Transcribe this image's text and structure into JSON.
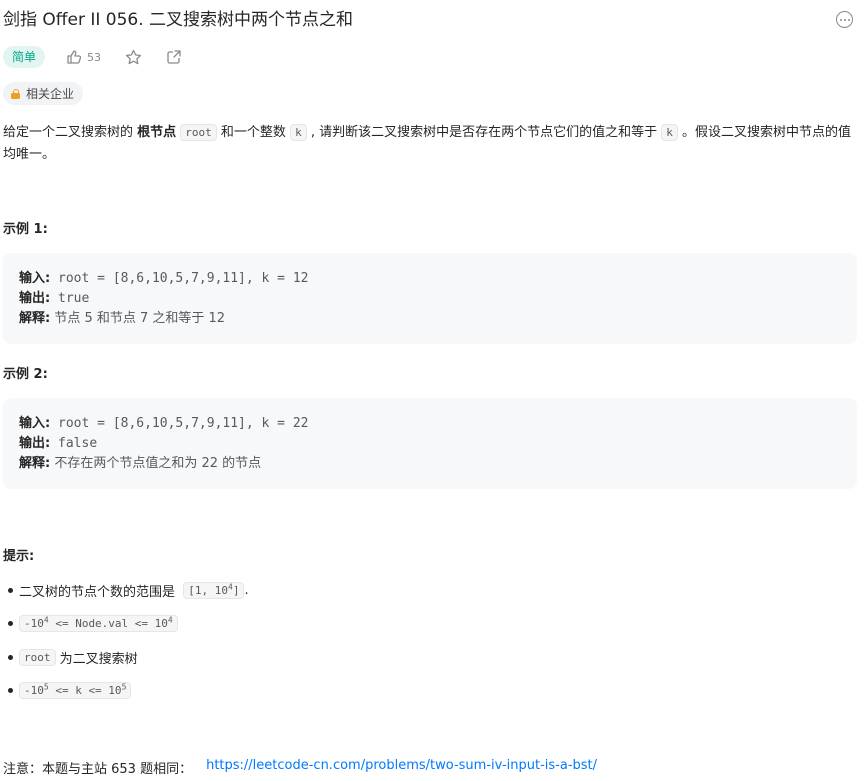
{
  "problem": {
    "title": "剑指 Offer II 056. 二叉搜索树中两个节点之和",
    "difficulty": "简单",
    "likes": "53",
    "company_tag": "相关企业",
    "icons": {
      "more": "more-icon",
      "like": "thumbs-up-icon",
      "star": "star-icon",
      "share": "share-icon",
      "lock": "lock-icon"
    },
    "accent_color": "#00a888"
  },
  "description": {
    "part1": "给定一个二叉搜索树的 ",
    "bold": "根节点",
    "code_root": "root",
    "part2": " 和一个整数 ",
    "code_k": "k",
    "part3": " , 请判断该二叉搜索树中是否存在两个节点它们的值之和等于 ",
    "code_k2": "k",
    "part4": " 。假设二叉搜索树中节点的值均唯一。"
  },
  "examples": [
    {
      "title": "示例 1:",
      "input_label": "输入:",
      "input": " root = [8,6,10,5,7,9,11], k = 12",
      "output_label": "输出:",
      "output": " true",
      "explain_label": "解释:",
      "explain": " 节点 5 和节点 7 之和等于 12"
    },
    {
      "title": "示例 2:",
      "input_label": "输入:",
      "input": " root = [8,6,10,5,7,9,11], k = 22",
      "output_label": "输出:",
      "output": " false",
      "explain_label": "解释:",
      "explain": " 不存在两个节点值之和为 22 的节点"
    }
  ],
  "hints": {
    "title": "提示:",
    "h1_text": "二叉树的节点个数的范围是",
    "h1_code_a": "[1, 10",
    "h1_code_exp": "4",
    "h1_code_b": "]",
    "h1_tail": ".",
    "h2_a": "-10",
    "h2_exp1": "4",
    "h2_b": " <= Node.val <= 10",
    "h2_exp2": "4",
    "h3_code": "root",
    "h3_text": "为二叉搜索树",
    "h4_a": "-10",
    "h4_exp1": "5",
    "h4_b": " <= k <= 10",
    "h4_exp2": "5"
  },
  "note": {
    "text": "注意：本题与主站 653 题相同：",
    "link": "https://leetcode-cn.com/problems/two-sum-iv-input-is-a-bst/"
  }
}
